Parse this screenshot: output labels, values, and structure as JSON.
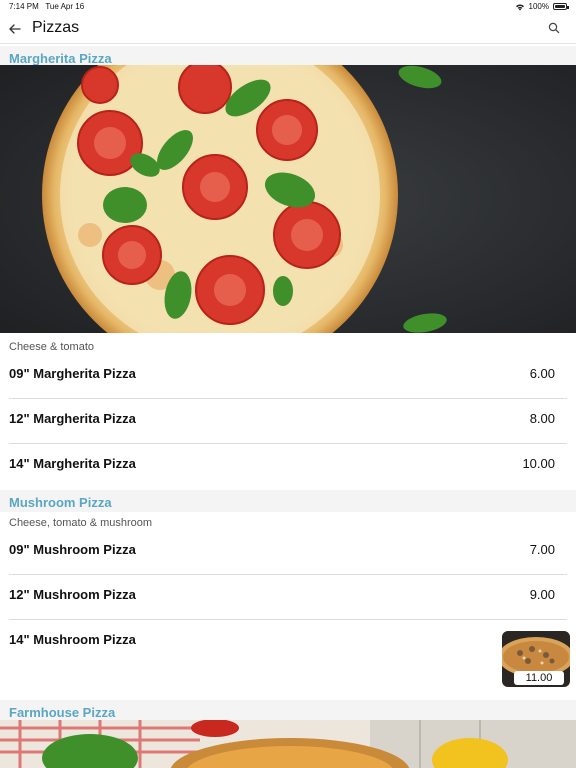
{
  "status_bar": {
    "time": "7:14 PM",
    "date": "Tue Apr 16",
    "battery": "100%"
  },
  "nav": {
    "title": "Pizzas",
    "back_icon": "back-arrow-icon",
    "search_icon": "search-icon"
  },
  "sections": [
    {
      "title": "Margherita Pizza",
      "description": "Cheese & tomato",
      "items": [
        {
          "name": "09\" Margherita Pizza",
          "price": "6.00"
        },
        {
          "name": "12\" Margherita Pizza",
          "price": "8.00"
        },
        {
          "name": "14\" Margherita Pizza",
          "price": "10.00"
        }
      ]
    },
    {
      "title": "Mushroom Pizza",
      "description": "Cheese, tomato & mushroom",
      "items": [
        {
          "name": "09\" Mushroom Pizza",
          "price": "7.00"
        },
        {
          "name": "12\" Mushroom Pizza",
          "price": "9.00"
        },
        {
          "name": "14\" Mushroom Pizza",
          "price": "11.00"
        }
      ]
    },
    {
      "title": "Farmhouse Pizza"
    }
  ],
  "colors": {
    "section_title": "#5aa7c4",
    "section_bg": "#f4f4f4"
  }
}
